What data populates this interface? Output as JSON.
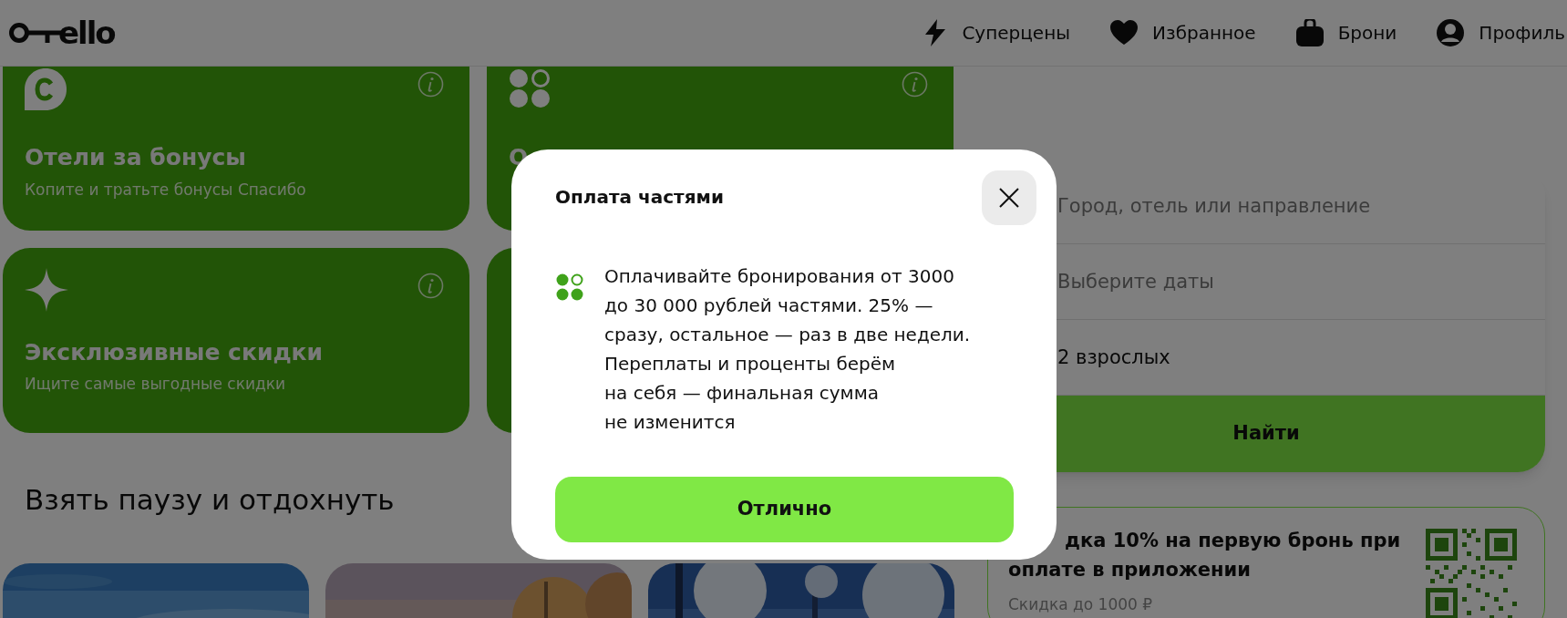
{
  "header": {
    "logo": "ello",
    "nav": [
      {
        "label": "Суперцены"
      },
      {
        "label": "Избранное"
      },
      {
        "label": "Брони"
      },
      {
        "label": "Профиль"
      }
    ]
  },
  "feature_cards": [
    {
      "kind": "card",
      "title": "Отели за бонусы",
      "subtitle": "Копите и тратьте бонусы Спасибо"
    },
    {
      "kind": "card",
      "title": "О"
    },
    {
      "kind": "card",
      "title": "Эксклюзивные скидки",
      "subtitle": "Ищите самые выгодные скидки"
    },
    {
      "kind": "card"
    }
  ],
  "section_title": "Взять паузу и отдохнуть",
  "search": {
    "fields": [
      {
        "placeholder": "Город, отель или направление"
      },
      {
        "placeholder": "Выберите даты"
      },
      {
        "value": "2 взрослых"
      }
    ],
    "button": "Найти"
  },
  "promo": {
    "title_lines": [
      "дка 10% на первую бронь при",
      "оплате в приложении"
    ],
    "subtitle": "Скидка до 1000 ₽"
  },
  "modal": {
    "title": "Оплата частями",
    "text_lines": [
      "Оплачивайте бронирования от 3000",
      "до 30 000 рублей частями. 25% —",
      "сразу, остальное — раз в две недели.",
      "Переплаты и проценты берём",
      "на себя — финальная сумма",
      "не изменится"
    ],
    "button": "Отлично"
  }
}
